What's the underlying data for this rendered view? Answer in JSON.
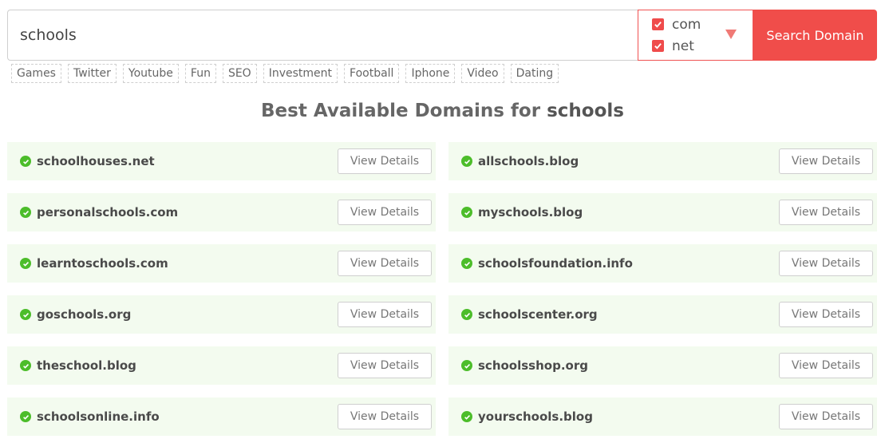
{
  "search": {
    "value": "schools",
    "button_label": "Search Domain"
  },
  "tld_options": [
    {
      "label": "com",
      "checked": true
    },
    {
      "label": "net",
      "checked": true
    }
  ],
  "tags": [
    "Games",
    "Twitter",
    "Youtube",
    "Fun",
    "SEO",
    "Investment",
    "Football",
    "Iphone",
    "Video",
    "Dating"
  ],
  "heading": {
    "prefix": "Best Available Domains for",
    "keyword": "schools"
  },
  "view_details_label": "View Details",
  "results": [
    "schoolhouses.net",
    "allschools.blog",
    "personalschools.com",
    "myschools.blog",
    "learntoschools.com",
    "schoolsfoundation.info",
    "goschools.org",
    "schoolscenter.org",
    "theschool.blog",
    "schoolsshop.org",
    "schoolsonline.info",
    "yourschools.blog"
  ],
  "colors": {
    "accent": "#f04d4a",
    "available": "#4cbd2a",
    "row_bg": "#f3fbef"
  }
}
